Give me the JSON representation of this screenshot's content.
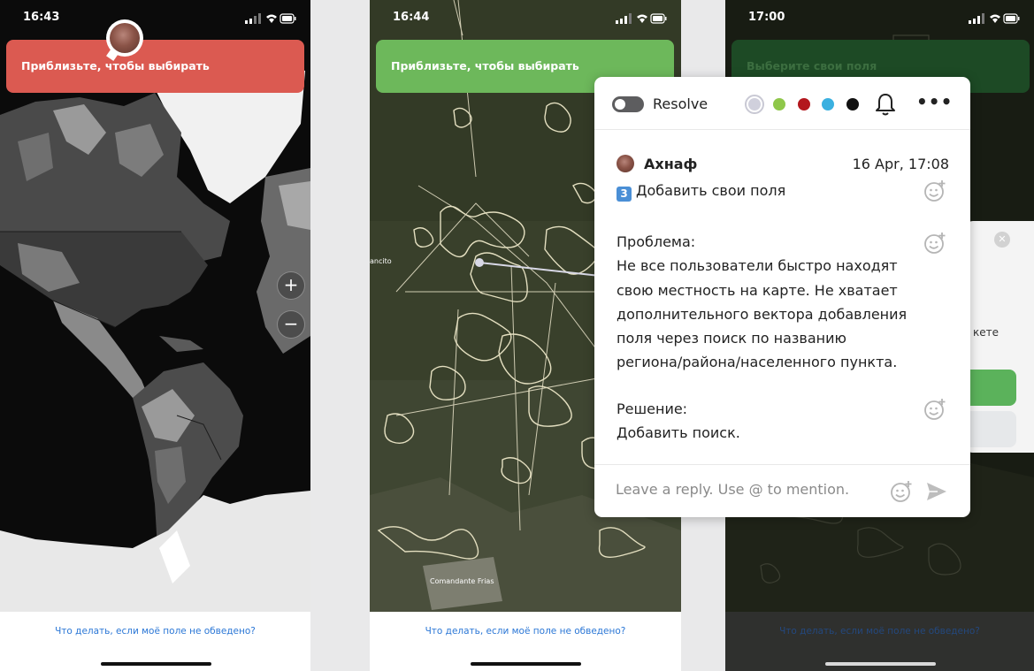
{
  "phones": [
    {
      "time": "16:43",
      "banner": "Приблизьте, чтобы выбирать",
      "zoom_in": "+",
      "zoom_out": "−",
      "bottom_link": "Что делать, если моё поле не обведено?"
    },
    {
      "time": "16:44",
      "banner": "Приблизьте, чтобы выбирать",
      "map_labels": [
        "ancito",
        "Comandante Frias"
      ],
      "bottom_link": "Что делать, если моё поле не обведено?"
    },
    {
      "time": "17:00",
      "banner": "Выберите свои поля",
      "dialog_partial_text": "кете",
      "bottom_link": "Что делать, если моё поле не обведено?"
    }
  ],
  "comment": {
    "resolve_label": "Resolve",
    "colors": [
      "#d0d0dc",
      "#8fc74a",
      "#b3171d",
      "#3ab0e0",
      "#111111"
    ],
    "author": "Ахнаф",
    "timestamp": "16 Apr, 17:08",
    "keycap": "3",
    "title": "Добавить свои поля",
    "problem_label": "Проблема:",
    "problem_lines": [
      "Не все пользователи быстро находят",
      "свою местность на карте. Не хватает",
      "дополнительного вектора добавления",
      "поля через поиск по названию",
      "региона/района/населенного пункта."
    ],
    "solution_label": "Решение:",
    "solution_text": "Добавить поиск.",
    "reply_placeholder": "Leave a reply. Use @ to mention."
  }
}
